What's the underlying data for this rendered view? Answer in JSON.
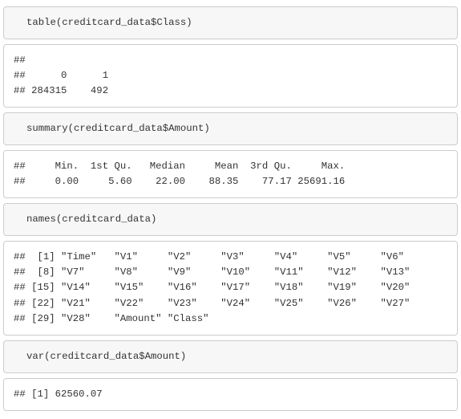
{
  "cells": {
    "c1_code": "table(creditcard_data$Class)",
    "c1_out": "## \n##      0      1 \n## 284315    492",
    "c2_code": "summary(creditcard_data$Amount)",
    "c2_out": "##     Min.  1st Qu.   Median     Mean  3rd Qu.     Max. \n##     0.00     5.60    22.00    88.35    77.17 25691.16",
    "c3_code": "names(creditcard_data)",
    "c3_out": "##  [1] \"Time\"   \"V1\"     \"V2\"     \"V3\"     \"V4\"     \"V5\"     \"V6\"    \n##  [8] \"V7\"     \"V8\"     \"V9\"     \"V10\"    \"V11\"    \"V12\"    \"V13\"   \n## [15] \"V14\"    \"V15\"    \"V16\"    \"V17\"    \"V18\"    \"V19\"    \"V20\"   \n## [22] \"V21\"    \"V22\"    \"V23\"    \"V24\"    \"V25\"    \"V26\"    \"V27\"   \n## [29] \"V28\"    \"Amount\" \"Class\"",
    "c4_code": "var(creditcard_data$Amount)",
    "c4_out": "## [1] 62560.07"
  },
  "chart_data": {
    "type": "table",
    "class_table": {
      "0": 284315,
      "1": 492
    },
    "amount_summary": {
      "Min.": 0.0,
      "1st Qu.": 5.6,
      "Median": 22.0,
      "Mean": 88.35,
      "3rd Qu.": 77.17,
      "Max.": 25691.16
    },
    "column_names": [
      "Time",
      "V1",
      "V2",
      "V3",
      "V4",
      "V5",
      "V6",
      "V7",
      "V8",
      "V9",
      "V10",
      "V11",
      "V12",
      "V13",
      "V14",
      "V15",
      "V16",
      "V17",
      "V18",
      "V19",
      "V20",
      "V21",
      "V22",
      "V23",
      "V24",
      "V25",
      "V26",
      "V27",
      "V28",
      "Amount",
      "Class"
    ],
    "amount_variance": 62560.07
  }
}
